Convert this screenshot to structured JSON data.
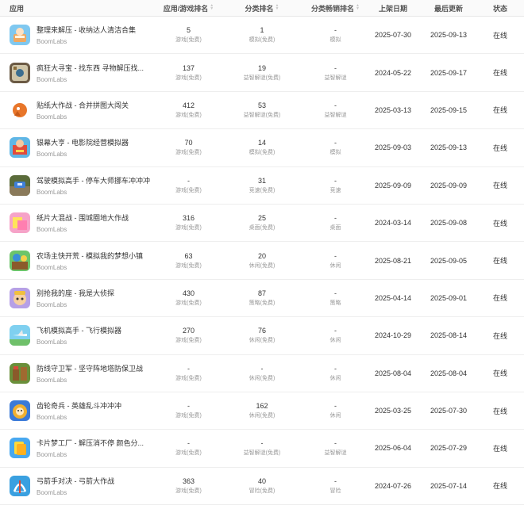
{
  "headers": {
    "app": "应用",
    "rank": "应用/游戏排名",
    "cat": "分类排名",
    "flow": "分类畅销排名",
    "release": "上架日期",
    "updated": "最后更新",
    "status": "状态"
  },
  "rows": [
    {
      "name": "整理来解压 - 收纳达人清洁合集",
      "dev": "BoomLabs",
      "rank": "5",
      "rank_sub": "游戏(免费)",
      "cat": "1",
      "cat_sub": "模拟(免费)",
      "flow": "-",
      "flow_sub": "模拟",
      "release": "2025-07-30",
      "updated": "2025-09-13",
      "status": "在线",
      "icon": "organize-icon"
    },
    {
      "name": "疯狂大寻宝 - 找东西 寻物解压找...",
      "dev": "BoomLabs",
      "rank": "137",
      "rank_sub": "游戏(免费)",
      "cat": "19",
      "cat_sub": "益智解谜(免费)",
      "flow": "-",
      "flow_sub": "益智解谜",
      "release": "2024-05-22",
      "updated": "2025-09-17",
      "status": "在线",
      "icon": "treasure-icon"
    },
    {
      "name": "贴纸大作战 - 合并拼图大闯关",
      "dev": "BoomLabs",
      "rank": "412",
      "rank_sub": "游戏(免费)",
      "cat": "53",
      "cat_sub": "益智解谜(免费)",
      "flow": "-",
      "flow_sub": "益智解谜",
      "release": "2025-03-13",
      "updated": "2025-09-15",
      "status": "在线",
      "icon": "sticker-icon"
    },
    {
      "name": "银幕大亨 - 电影院经营模拟器",
      "dev": "BoomLabs",
      "rank": "70",
      "rank_sub": "游戏(免费)",
      "cat": "14",
      "cat_sub": "模拟(免费)",
      "flow": "-",
      "flow_sub": "模拟",
      "release": "2025-09-03",
      "updated": "2025-09-13",
      "status": "在线",
      "icon": "cinema-icon"
    },
    {
      "name": "驾驶模拟高手 - 停车大师挪车冲冲冲",
      "dev": "BoomLabs",
      "rank": "-",
      "rank_sub": "游戏(免费)",
      "cat": "31",
      "cat_sub": "竞速(免费)",
      "flow": "-",
      "flow_sub": "竞速",
      "release": "2025-09-09",
      "updated": "2025-09-09",
      "status": "在线",
      "icon": "car-icon"
    },
    {
      "name": "纸片大混战 - 围城圈地大作战",
      "dev": "BoomLabs",
      "rank": "316",
      "rank_sub": "游戏(免费)",
      "cat": "25",
      "cat_sub": "桌面(免费)",
      "flow": "-",
      "flow_sub": "桌面",
      "release": "2024-03-14",
      "updated": "2025-09-08",
      "status": "在线",
      "icon": "paper-icon"
    },
    {
      "name": "农场主快开荒 - 模拟我的梦想小镇",
      "dev": "BoomLabs",
      "rank": "63",
      "rank_sub": "游戏(免费)",
      "cat": "20",
      "cat_sub": "休闲(免费)",
      "flow": "-",
      "flow_sub": "休闲",
      "release": "2025-08-21",
      "updated": "2025-09-05",
      "status": "在线",
      "icon": "farm-icon"
    },
    {
      "name": "别抢我的座 - 我是大侦探",
      "dev": "BoomLabs",
      "rank": "430",
      "rank_sub": "游戏(免费)",
      "cat": "87",
      "cat_sub": "策略(免费)",
      "flow": "-",
      "flow_sub": "策略",
      "release": "2025-04-14",
      "updated": "2025-09-01",
      "status": "在线",
      "icon": "detective-icon"
    },
    {
      "name": "飞机模拟高手 - 飞行模拟器",
      "dev": "BoomLabs",
      "rank": "270",
      "rank_sub": "游戏(免费)",
      "cat": "76",
      "cat_sub": "休闲(免费)",
      "flow": "-",
      "flow_sub": "休闲",
      "release": "2024-10-29",
      "updated": "2025-08-14",
      "status": "在线",
      "icon": "plane-icon"
    },
    {
      "name": "防线守卫军 - 坚守阵地塔防保卫战",
      "dev": "BoomLabs",
      "rank": "-",
      "rank_sub": "游戏(免费)",
      "cat": "-",
      "cat_sub": "休闲(免费)",
      "flow": "-",
      "flow_sub": "休闲",
      "release": "2025-08-04",
      "updated": "2025-08-04",
      "status": "在线",
      "icon": "tower-icon"
    },
    {
      "name": "齿轮奇兵 - 英雄乱斗冲冲冲",
      "dev": "BoomLabs",
      "rank": "-",
      "rank_sub": "游戏(免费)",
      "cat": "162",
      "cat_sub": "休闲(免费)",
      "flow": "-",
      "flow_sub": "休闲",
      "release": "2025-03-25",
      "updated": "2025-07-30",
      "status": "在线",
      "icon": "gear-hero-icon"
    },
    {
      "name": "卡片梦工厂 - 解压消不停 颜色分...",
      "dev": "BoomLabs",
      "rank": "-",
      "rank_sub": "游戏(免费)",
      "cat": "-",
      "cat_sub": "益智解谜(免费)",
      "flow": "-",
      "flow_sub": "益智解谜",
      "release": "2025-06-04",
      "updated": "2025-07-29",
      "status": "在线",
      "icon": "card-icon"
    },
    {
      "name": "弓箭手对决 - 弓箭大作战",
      "dev": "BoomLabs",
      "rank": "363",
      "rank_sub": "游戏(免费)",
      "cat": "40",
      "cat_sub": "冒险(免费)",
      "flow": "-",
      "flow_sub": "冒险",
      "release": "2024-07-26",
      "updated": "2025-07-14",
      "status": "在线",
      "icon": "archer-icon"
    }
  ]
}
